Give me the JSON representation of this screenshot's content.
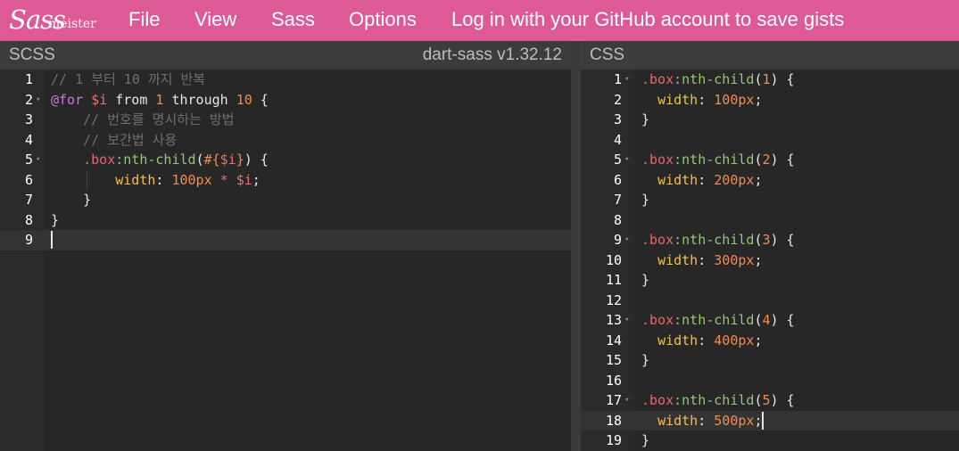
{
  "topbar": {
    "logo_sass": "Sass",
    "logo_meister": "meister",
    "menu": [
      "File",
      "View",
      "Sass",
      "Options",
      "Log in with your GitHub account to save gists"
    ]
  },
  "scss_panel": {
    "title": "SCSS",
    "version": "dart-sass v1.32.12",
    "lines": [
      [
        {
          "t": "// 1 부터 10 까지 반복",
          "c": "comment"
        }
      ],
      [
        {
          "t": "@for",
          "c": "at"
        },
        {
          "t": " ",
          "c": "kw"
        },
        {
          "t": "$i",
          "c": "var"
        },
        {
          "t": " from ",
          "c": "kw"
        },
        {
          "t": "1",
          "c": "num"
        },
        {
          "t": " through ",
          "c": "kw"
        },
        {
          "t": "10",
          "c": "num"
        },
        {
          "t": " {",
          "c": "punc"
        }
      ],
      [
        {
          "t": "    // 번호를 명시하는 방법",
          "c": "comment"
        }
      ],
      [
        {
          "t": "    // 보간법 사용",
          "c": "comment"
        }
      ],
      [
        {
          "t": "    ",
          "c": "kw"
        },
        {
          "t": ".box",
          "c": "sel"
        },
        {
          "t": ":nth-child",
          "c": "pseudo"
        },
        {
          "t": "(",
          "c": "punc"
        },
        {
          "t": "#{",
          "c": "interp"
        },
        {
          "t": "$i",
          "c": "var"
        },
        {
          "t": "}",
          "c": "interp"
        },
        {
          "t": ") {",
          "c": "punc"
        }
      ],
      [
        {
          "t": "        ",
          "c": "kw"
        },
        {
          "t": "width",
          "c": "prop"
        },
        {
          "t": ": ",
          "c": "punc"
        },
        {
          "t": "100px",
          "c": "num"
        },
        {
          "t": " * ",
          "c": "var"
        },
        {
          "t": "$i",
          "c": "var"
        },
        {
          "t": ";",
          "c": "punc"
        }
      ],
      [
        {
          "t": "    }",
          "c": "punc"
        }
      ],
      [
        {
          "t": "}",
          "c": "punc"
        }
      ],
      []
    ],
    "folds": [
      2,
      5
    ],
    "active_line": 9
  },
  "css_panel": {
    "title": "CSS",
    "lines": [
      [
        {
          "t": ".box",
          "c": "sel"
        },
        {
          "t": ":nth-child",
          "c": "pseudo"
        },
        {
          "t": "(",
          "c": "punc"
        },
        {
          "t": "1",
          "c": "num"
        },
        {
          "t": ") {",
          "c": "punc"
        }
      ],
      [
        {
          "t": "  ",
          "c": "kw"
        },
        {
          "t": "width",
          "c": "prop"
        },
        {
          "t": ": ",
          "c": "punc"
        },
        {
          "t": "100px",
          "c": "num"
        },
        {
          "t": ";",
          "c": "punc"
        }
      ],
      [
        {
          "t": "}",
          "c": "punc"
        }
      ],
      [],
      [
        {
          "t": ".box",
          "c": "sel"
        },
        {
          "t": ":nth-child",
          "c": "pseudo"
        },
        {
          "t": "(",
          "c": "punc"
        },
        {
          "t": "2",
          "c": "num"
        },
        {
          "t": ") {",
          "c": "punc"
        }
      ],
      [
        {
          "t": "  ",
          "c": "kw"
        },
        {
          "t": "width",
          "c": "prop"
        },
        {
          "t": ": ",
          "c": "punc"
        },
        {
          "t": "200px",
          "c": "num"
        },
        {
          "t": ";",
          "c": "punc"
        }
      ],
      [
        {
          "t": "}",
          "c": "punc"
        }
      ],
      [],
      [
        {
          "t": ".box",
          "c": "sel"
        },
        {
          "t": ":nth-child",
          "c": "pseudo"
        },
        {
          "t": "(",
          "c": "punc"
        },
        {
          "t": "3",
          "c": "num"
        },
        {
          "t": ") {",
          "c": "punc"
        }
      ],
      [
        {
          "t": "  ",
          "c": "kw"
        },
        {
          "t": "width",
          "c": "prop"
        },
        {
          "t": ": ",
          "c": "punc"
        },
        {
          "t": "300px",
          "c": "num"
        },
        {
          "t": ";",
          "c": "punc"
        }
      ],
      [
        {
          "t": "}",
          "c": "punc"
        }
      ],
      [],
      [
        {
          "t": ".box",
          "c": "sel"
        },
        {
          "t": ":nth-child",
          "c": "pseudo"
        },
        {
          "t": "(",
          "c": "punc"
        },
        {
          "t": "4",
          "c": "num"
        },
        {
          "t": ") {",
          "c": "punc"
        }
      ],
      [
        {
          "t": "  ",
          "c": "kw"
        },
        {
          "t": "width",
          "c": "prop"
        },
        {
          "t": ": ",
          "c": "punc"
        },
        {
          "t": "400px",
          "c": "num"
        },
        {
          "t": ";",
          "c": "punc"
        }
      ],
      [
        {
          "t": "}",
          "c": "punc"
        }
      ],
      [],
      [
        {
          "t": ".box",
          "c": "sel"
        },
        {
          "t": ":nth-child",
          "c": "pseudo"
        },
        {
          "t": "(",
          "c": "punc"
        },
        {
          "t": "5",
          "c": "num"
        },
        {
          "t": ") {",
          "c": "punc"
        }
      ],
      [
        {
          "t": "  ",
          "c": "kw"
        },
        {
          "t": "width",
          "c": "prop"
        },
        {
          "t": ": ",
          "c": "punc"
        },
        {
          "t": "500px",
          "c": "num"
        },
        {
          "t": ";",
          "c": "punc"
        }
      ],
      [
        {
          "t": "}",
          "c": "punc"
        }
      ]
    ],
    "folds": [
      1,
      5,
      9,
      13,
      17
    ],
    "active_line": 18
  },
  "colors": {
    "topbar": "#dd5a96",
    "editor_bg": "#272727",
    "header_bg": "#3c3c3c"
  }
}
